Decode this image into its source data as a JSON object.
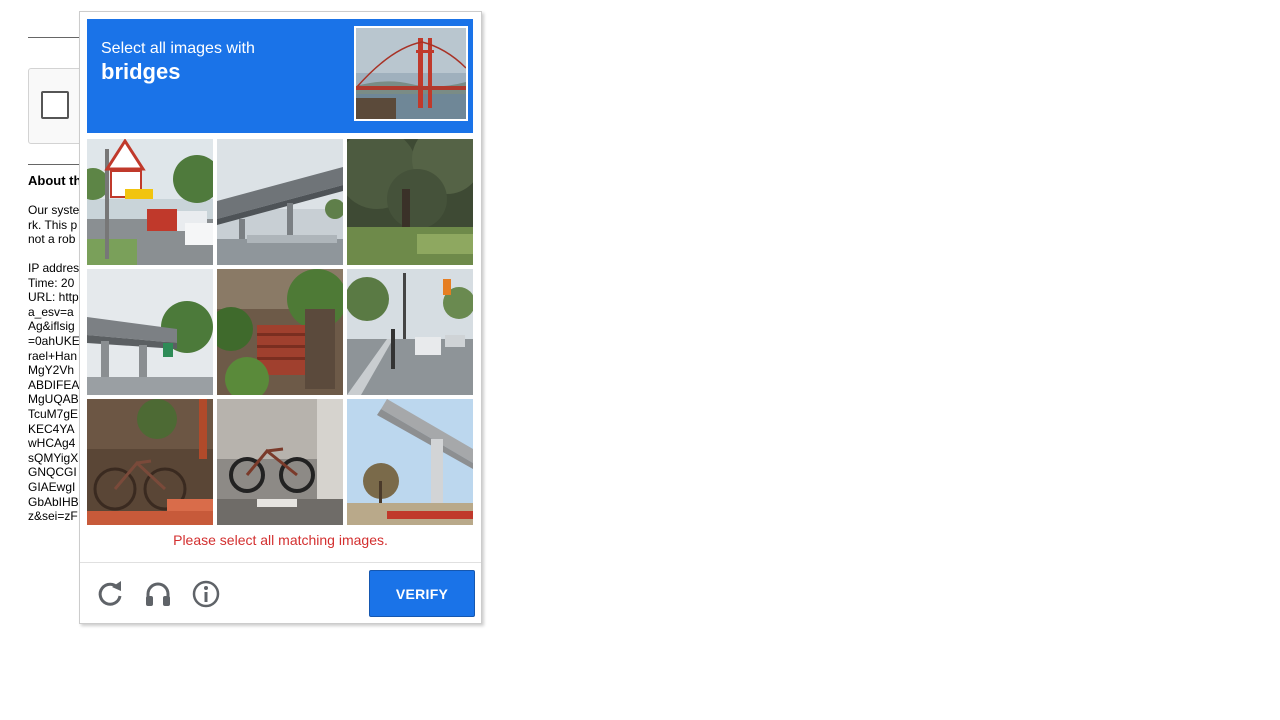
{
  "background_page": {
    "heading": "About th",
    "paragraph_lines": [
      "Our syste",
      "rk. This p",
      "not a rob"
    ],
    "details_lines": [
      "IP addres",
      "Time: 20",
      "URL: http",
      "a_esv=a",
      "Ag&iflsig",
      "=0ahUKE",
      "rael+Han",
      "MgY2Vh",
      "ABDIFEA",
      "MgUQAB",
      "TcuM7gE",
      "KEC4YA",
      "wHCAg4",
      "sQMYigX",
      "GNQCGI",
      "GIAEwgI",
      "GbAbIHB",
      "z&sei=zF"
    ]
  },
  "challenge": {
    "instruction_small": "Select all images with",
    "instruction_target": "bridges",
    "sample_image": "golden-gate-bridge-photo",
    "tiles": [
      {
        "name": "tile-traffic-sign-road",
        "selected": false
      },
      {
        "name": "tile-highway-overpass",
        "selected": false
      },
      {
        "name": "tile-trees-grass",
        "selected": false
      },
      {
        "name": "tile-overpass-road",
        "selected": false
      },
      {
        "name": "tile-garden-steps",
        "selected": false
      },
      {
        "name": "tile-street-cars",
        "selected": false
      },
      {
        "name": "tile-bicycle-wall",
        "selected": false
      },
      {
        "name": "tile-bicycles-parked",
        "selected": false
      },
      {
        "name": "tile-elevated-bridge",
        "selected": false
      }
    ],
    "error_message": "Please select all matching images.",
    "verify_label": "VERIFY",
    "icons": [
      "reload-icon",
      "headphones-icon",
      "info-icon"
    ]
  },
  "colors": {
    "header_blue": "#1a73e8",
    "error_red": "#d32f2f"
  }
}
